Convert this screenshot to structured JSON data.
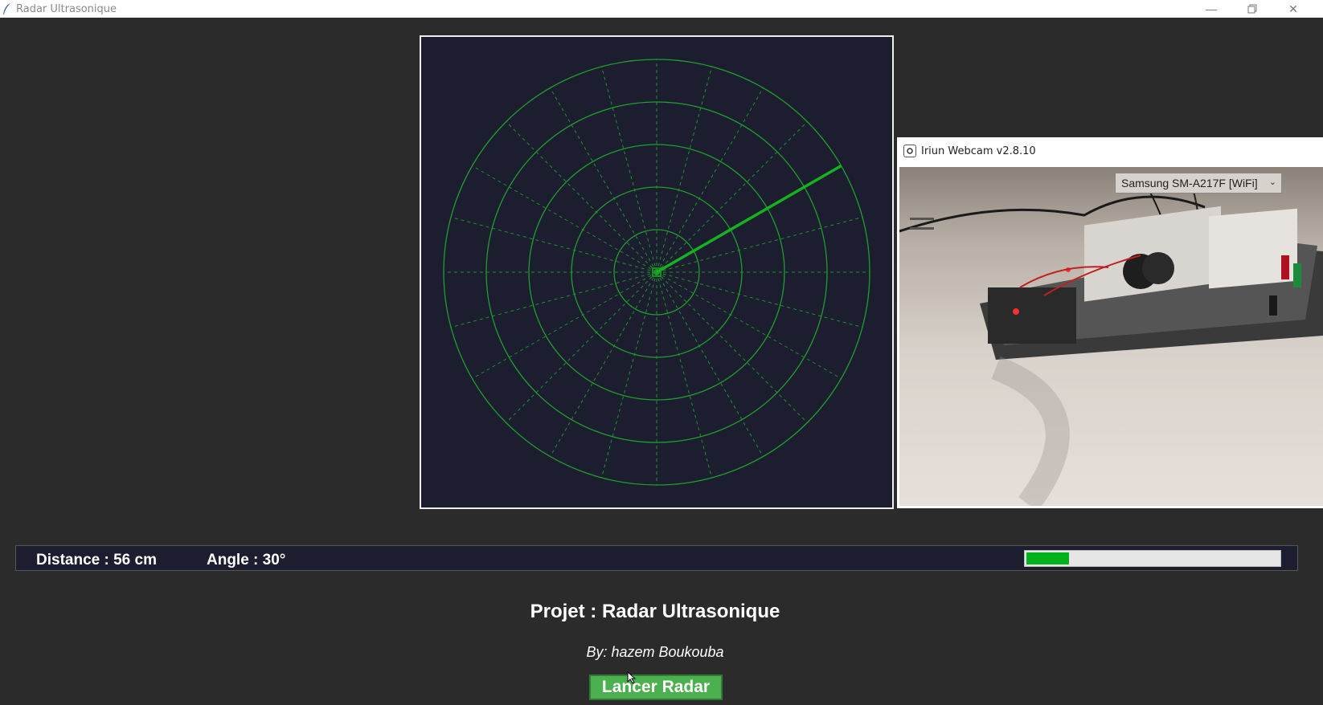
{
  "window": {
    "title": "Radar Ultrasonique",
    "icon": "feather-icon",
    "controls": [
      "minimize-icon",
      "restore-icon",
      "close-icon"
    ]
  },
  "radar": {
    "distance_cm": 56,
    "angle_deg": 30,
    "grid_color": "#1f9e2e",
    "sweep_color": "#14b21e",
    "background": "#1c1d2e"
  },
  "webcam": {
    "title": "Iriun Webcam v2.8.10",
    "device": "Samsung SM-A217F [WiFi]",
    "icon": "webcam-icon"
  },
  "status": {
    "distance_label": "Distance : 56 cm",
    "angle_label": "Angle : 30°",
    "progress_fraction": 0.17,
    "progress_color": "#00b31c"
  },
  "footer": {
    "project": "Projet : Radar Ultrasonique",
    "author": "By: hazem Boukouba",
    "button": "Lancer Radar",
    "button_color": "#4caf50"
  }
}
